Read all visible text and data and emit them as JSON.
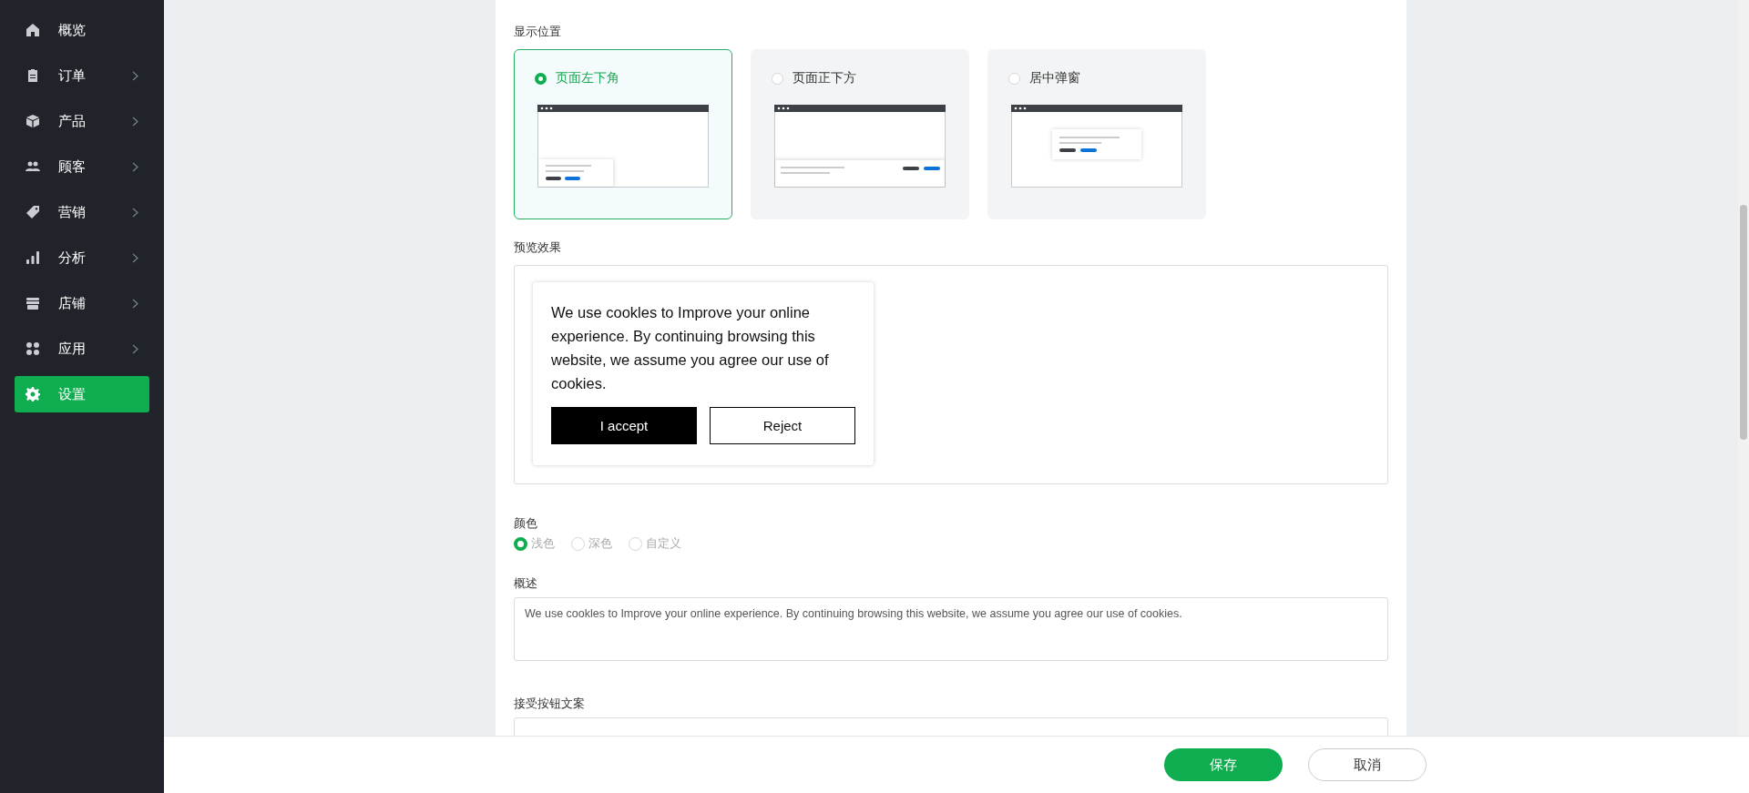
{
  "sidebar": {
    "items": [
      {
        "label": "概览",
        "expandable": false,
        "selected": false
      },
      {
        "label": "订单",
        "expandable": true,
        "selected": false
      },
      {
        "label": "产品",
        "expandable": true,
        "selected": false
      },
      {
        "label": "顾客",
        "expandable": true,
        "selected": false
      },
      {
        "label": "营销",
        "expandable": true,
        "selected": false
      },
      {
        "label": "分析",
        "expandable": true,
        "selected": false
      },
      {
        "label": "店铺",
        "expandable": true,
        "selected": false
      },
      {
        "label": "应用",
        "expandable": true,
        "selected": false
      },
      {
        "label": "设置",
        "expandable": false,
        "selected": true
      }
    ]
  },
  "display_position": {
    "label": "显示位置",
    "options": [
      {
        "label": "页面左下角",
        "kind": "corner",
        "selected": true
      },
      {
        "label": "页面正下方",
        "kind": "bar",
        "selected": false
      },
      {
        "label": "居中弹窗",
        "kind": "center",
        "selected": false
      }
    ]
  },
  "preview": {
    "label": "预览效果",
    "popup": {
      "text": "We use cookles to Improve your online experience. By continuing browsing this website, we assume you agree our use of cookies.",
      "accept_button": "I accept",
      "reject_button": "Reject"
    }
  },
  "color": {
    "label": "颜色",
    "options": [
      {
        "label": "浅色",
        "selected": true
      },
      {
        "label": "深色",
        "selected": false
      },
      {
        "label": "自定义",
        "selected": false
      }
    ]
  },
  "description": {
    "label": "概述",
    "value": "We use cookles to Improve your online experience. By continuing browsing this website, we assume you agree our use of cookies."
  },
  "accept_text": {
    "label": "接受按钮文案"
  },
  "footer": {
    "save_button": "保存",
    "cancel_button": "取消"
  }
}
